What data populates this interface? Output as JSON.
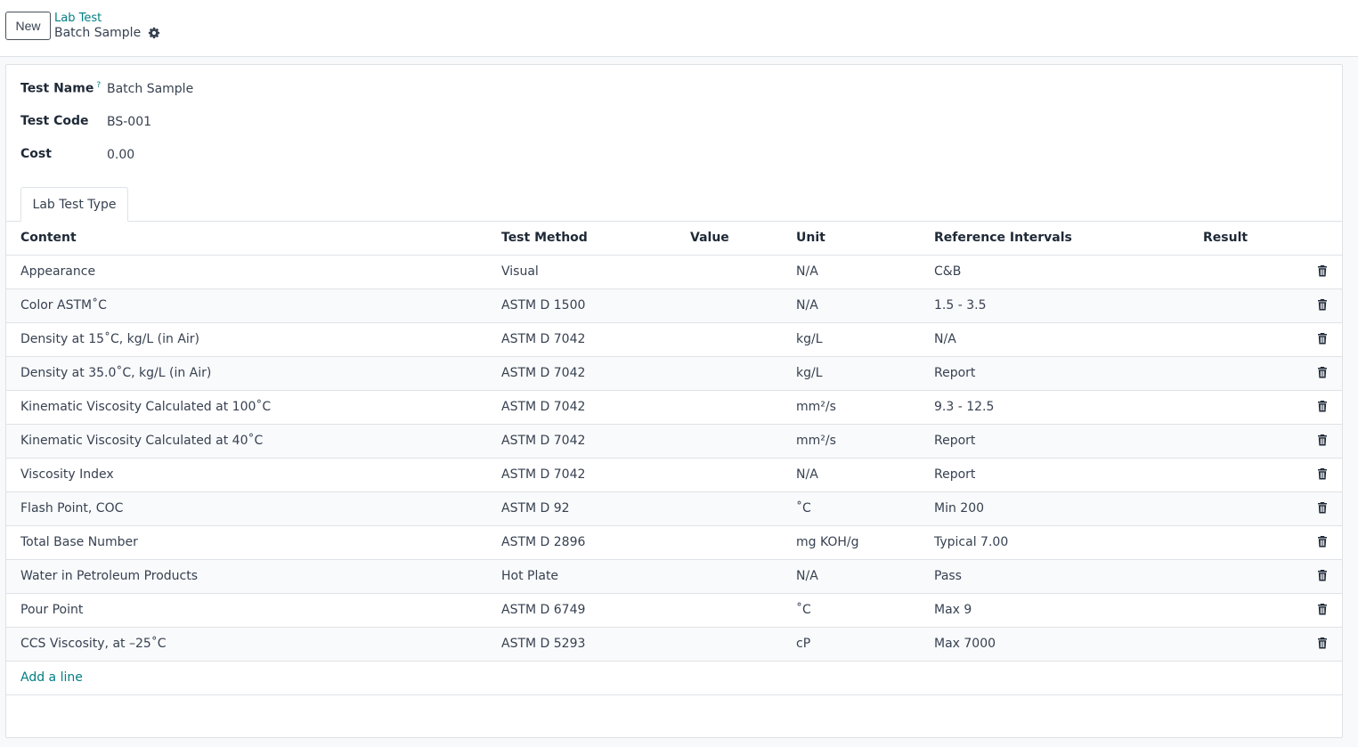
{
  "header": {
    "new_button": "New",
    "breadcrumb_parent": "Lab Test",
    "breadcrumb_current": "Batch Sample",
    "settings_icon": "gear-icon"
  },
  "form": {
    "test_name_label": "Test Name",
    "test_name_help": "?",
    "test_name_value": "Batch Sample",
    "test_code_label": "Test Code",
    "test_code_value": "BS-001",
    "cost_label": "Cost",
    "cost_value": "0.00"
  },
  "tabs": [
    {
      "label": "Lab Test Type",
      "active": true
    }
  ],
  "table": {
    "columns": [
      "Content",
      "Test Method",
      "Value",
      "Unit",
      "Reference Intervals",
      "Result"
    ],
    "rows": [
      {
        "content": "Appearance",
        "method": "Visual",
        "value": "",
        "unit": "N/A",
        "reference": "C&B",
        "result": ""
      },
      {
        "content": "Color ASTM˚C",
        "method": "ASTM D 1500",
        "value": "",
        "unit": "N/A",
        "reference": "1.5 - 3.5",
        "result": ""
      },
      {
        "content": "Density at 15˚C, kg/L (in Air)",
        "method": "ASTM D 7042",
        "value": "",
        "unit": "kg/L",
        "reference": "N/A",
        "result": ""
      },
      {
        "content": "Density at 35.0˚C, kg/L (in Air)",
        "method": "ASTM D 7042",
        "value": "",
        "unit": "kg/L",
        "reference": "Report",
        "result": ""
      },
      {
        "content": "Kinematic Viscosity Calculated at 100˚C",
        "method": "ASTM D 7042",
        "value": "",
        "unit": "mm²/s",
        "reference": "9.3 - 12.5",
        "result": ""
      },
      {
        "content": "Kinematic Viscosity Calculated at 40˚C",
        "method": "ASTM D 7042",
        "value": "",
        "unit": "mm²/s",
        "reference": "Report",
        "result": ""
      },
      {
        "content": "Viscosity Index",
        "method": "ASTM D 7042",
        "value": "",
        "unit": "N/A",
        "reference": "Report",
        "result": ""
      },
      {
        "content": "Flash Point, COC",
        "method": "ASTM D 92",
        "value": "",
        "unit": "˚C",
        "reference": "Min 200",
        "result": ""
      },
      {
        "content": "Total Base Number",
        "method": "ASTM D 2896",
        "value": "",
        "unit": "mg KOH/g",
        "reference": "Typical 7.00",
        "result": ""
      },
      {
        "content": "Water in Petroleum Products",
        "method": "Hot Plate",
        "value": "",
        "unit": "N/A",
        "reference": "Pass",
        "result": ""
      },
      {
        "content": "Pour Point",
        "method": "ASTM D 6749",
        "value": "",
        "unit": "˚C",
        "reference": "Max 9",
        "result": ""
      },
      {
        "content": "CCS Viscosity, at –25˚C",
        "method": "ASTM D 5293",
        "value": "",
        "unit": "cP",
        "reference": "Max 7000",
        "result": ""
      }
    ],
    "row_action_icon": "trash-icon",
    "add_line": "Add a line"
  },
  "colors": {
    "accent": "#017e84",
    "border": "#dee2e6",
    "background": "#f8f9fa"
  }
}
